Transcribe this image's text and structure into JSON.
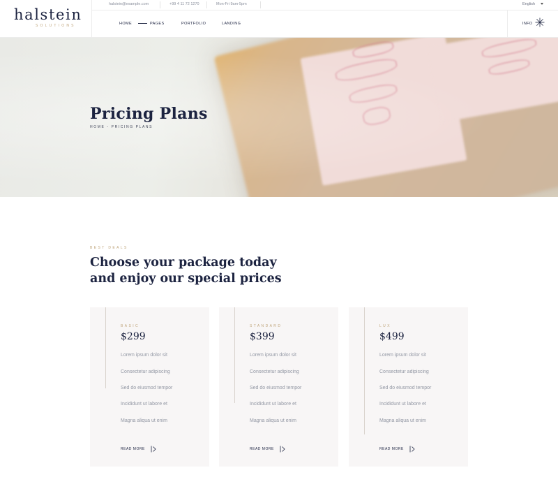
{
  "brand": {
    "name": "halstein",
    "tagline": "SOLUTIONS"
  },
  "topbar": {
    "email": "halstein@example.com",
    "phone": "+99 4 11 72 1270",
    "hours": "Mon-Fri 9am-5pm",
    "language": "English"
  },
  "nav": {
    "items": [
      "HOME",
      "PAGES",
      "PORTFOLIO",
      "LANDING"
    ],
    "info": "INFO"
  },
  "hero": {
    "title": "Pricing Plans",
    "breadcrumb": "HOME - PRICING PLANS"
  },
  "intro": {
    "eyebrow": "BEST DEALS",
    "headline_line1": "Choose your package today",
    "headline_line2": "and enjoy our special prices"
  },
  "plans": [
    {
      "tier": "BASIC",
      "price": "$299",
      "features": [
        "Lorem ipsum dolor sit",
        "Consectetur adipiscing",
        "Sed do eiusmod tempor",
        "Incididunt ut labore et",
        "Magna aliqua ut enim"
      ],
      "cta": "READ MORE"
    },
    {
      "tier": "STANDARD",
      "price": "$399",
      "features": [
        "Lorem ipsum dolor sit",
        "Consectetur adipiscing",
        "Sed do eiusmod tempor",
        "Incididunt ut labore et",
        "Magna aliqua ut enim"
      ],
      "cta": "READ MORE"
    },
    {
      "tier": "LUX",
      "price": "$499",
      "features": [
        "Lorem ipsum dolor sit",
        "Consectetur adipiscing",
        "Sed do eiusmod tempor",
        "Incididunt ut labore et",
        "Magna aliqua ut enim"
      ],
      "cta": "READ MORE"
    }
  ],
  "icons": {
    "language": "chevron-down-icon",
    "info": "asterisk-icon",
    "read_more": "arrow-right-icon"
  },
  "colors": {
    "primary": "#1c2340",
    "accent": "#bfa47a",
    "muted": "#9297a3",
    "card_bg": "#f8f6f6"
  }
}
